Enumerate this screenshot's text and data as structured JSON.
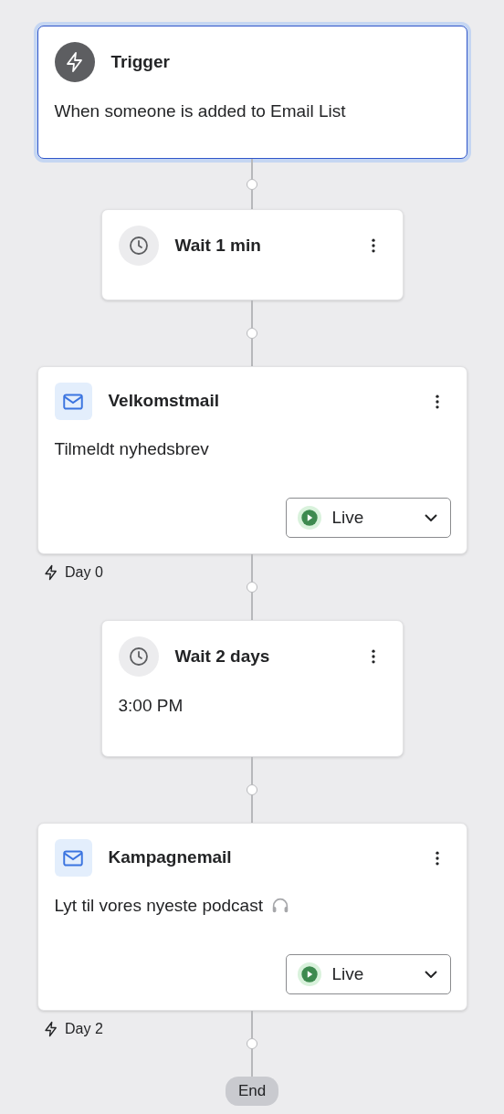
{
  "steps": [
    {
      "kind": "trigger",
      "title": "Trigger",
      "text": "When someone is added to Email List",
      "selected": true
    },
    {
      "kind": "wait",
      "title": "Wait 1 min",
      "selected": false
    },
    {
      "kind": "email",
      "title": "Velkomstmail",
      "text": "Tilmeldt nyhedsbrev",
      "status": "Live",
      "day": "Day 0",
      "selected": false
    },
    {
      "kind": "wait",
      "title": "Wait 2 days",
      "text": "3:00 PM",
      "selected": false
    },
    {
      "kind": "email",
      "title": "Kampagnemail",
      "text": "Lyt til vores nyeste podcast",
      "headphones_icon": true,
      "status": "Live",
      "day": "Day 2",
      "selected": false
    }
  ],
  "end": "End"
}
